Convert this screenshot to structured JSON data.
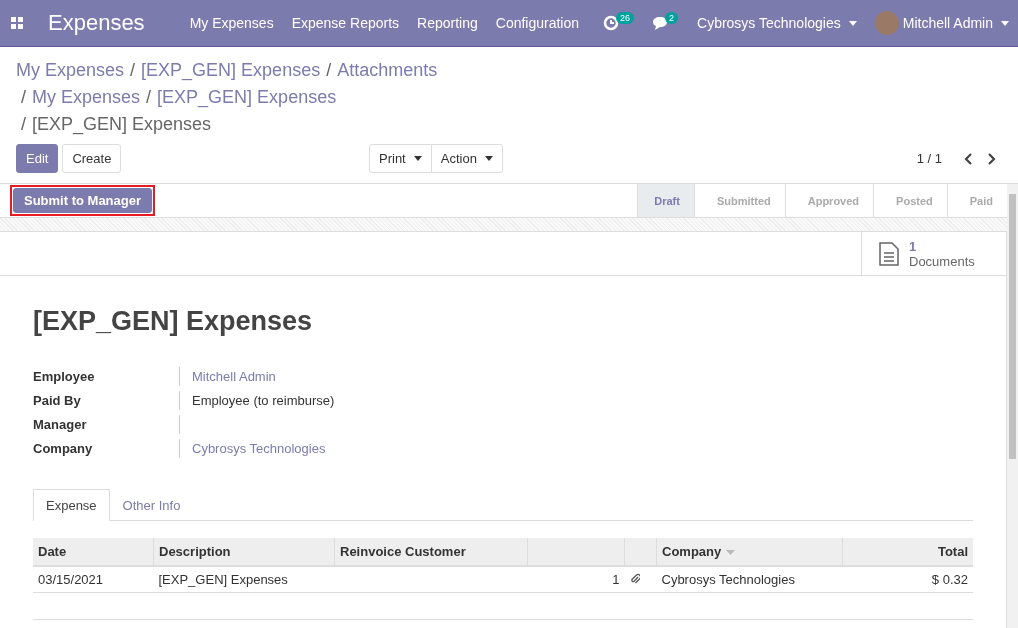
{
  "navbar": {
    "app_name": "Expenses",
    "menu": [
      "My Expenses",
      "Expense Reports",
      "Reporting",
      "Configuration"
    ],
    "activity_count": "26",
    "message_count": "2",
    "company": "Cybrosys Technologies",
    "user": "Mitchell Admin"
  },
  "breadcrumb_separator": "/",
  "breadcrumb_lines": [
    [
      {
        "label": "My Expenses",
        "current": false
      },
      {
        "label": "[EXP_GEN] Expenses",
        "current": false
      },
      {
        "label": "Attachments",
        "current": false
      }
    ],
    [
      {
        "label": "My Expenses",
        "current": false
      },
      {
        "label": "[EXP_GEN] Expenses",
        "current": false
      }
    ],
    [
      {
        "label": "[EXP_GEN] Expenses",
        "current": true
      }
    ]
  ],
  "control_buttons": [
    {
      "label": "Edit",
      "kind": "primary"
    },
    {
      "label": "Create",
      "kind": "secondary"
    }
  ],
  "dropdowns": [
    "Print",
    "Action"
  ],
  "pager": "1 / 1",
  "header_button": {
    "label": "Submit to Manager",
    "highlighted": true
  },
  "stages": [
    {
      "label": "Draft",
      "selected": true
    },
    {
      "label": "Submitted",
      "selected": false
    },
    {
      "label": "Approved",
      "selected": false
    },
    {
      "label": "Posted",
      "selected": false
    },
    {
      "label": "Paid",
      "selected": false
    }
  ],
  "smart_button": {
    "count": "1",
    "label": "Documents"
  },
  "title": "[EXP_GEN] Expenses",
  "fields": [
    {
      "label": "Employee",
      "value": "Mitchell Admin",
      "kind": "link"
    },
    {
      "label": "Paid By",
      "value": "Employee (to reimburse)",
      "kind": "text"
    },
    {
      "label": "Manager"
    },
    {
      "label": "Company",
      "value": "Cybrosys Technologies",
      "kind": "link"
    }
  ],
  "tabs": [
    {
      "label": "Expense",
      "selected": true
    },
    {
      "label": "Other Info",
      "selected": false
    }
  ],
  "table": {
    "columns": [
      {
        "label": "Date"
      },
      {
        "label": "Description"
      },
      {
        "label": "Reinvoice Customer"
      },
      {},
      {},
      {
        "label": "Company",
        "sorted": true
      },
      {
        "label": "Total"
      }
    ],
    "rows": [
      {
        "cells": [
          {
            "text": "03/15/2021"
          },
          {
            "text": "[EXP_GEN] Expenses"
          },
          {},
          {
            "text": "1"
          },
          {
            "kind": "attachment"
          },
          {
            "text": "Cybrosys Technologies"
          },
          {
            "text": "$ 0.32"
          }
        ]
      }
    ]
  }
}
